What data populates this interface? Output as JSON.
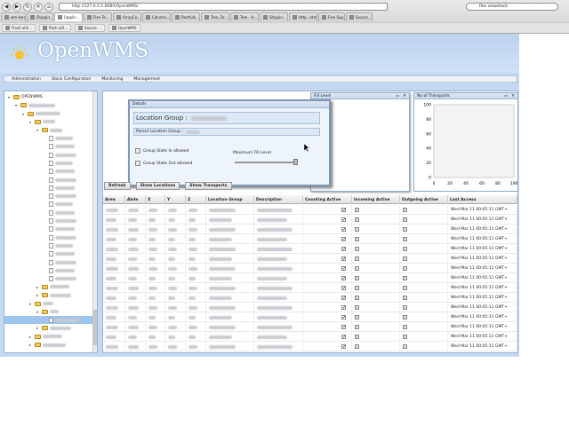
{
  "browser": {
    "url": "http://127.0.0.1:8080/OpenWMS/",
    "search": "flex viewstack",
    "tabs": [
      "wm-kern...",
      "Shippin...",
      "[applic...",
      "Flex Te...",
      "ArrayCo...",
      "Columni...",
      "Restfulk...",
      "Tree, Dr...",
      "Tree - A...",
      "Shippin...",
      "Http...html",
      "Flex Sup...",
      "Source ..."
    ],
    "active_tab_index": 2,
    "bookmarks": [
      "Flash utili...",
      "flash util...",
      "Source ...",
      "OpenWMS"
    ]
  },
  "app": {
    "logo": "OpenWMS",
    "menu": [
      "Administration",
      "Stock Configuration",
      "Monitoring",
      "Management"
    ]
  },
  "tree": {
    "root": "OPENWMS",
    "selected_index": 27
  },
  "fill_window": {
    "title": "Fill Level"
  },
  "transports_window": {
    "title": "No of Transports",
    "chart_data": {
      "type": "bar",
      "title": "",
      "ylim": [
        0,
        100
      ],
      "yticks": [
        "100",
        "80",
        "60",
        "40",
        "20",
        "0"
      ],
      "xticks": [
        "0",
        "20",
        "40",
        "60",
        "80",
        "100"
      ],
      "values": []
    }
  },
  "details": {
    "title": "Details",
    "location_group_label": "Location Group :",
    "parent_label": "Parent Location Group :",
    "state_in_label": "Group State In allowed",
    "state_out_label": "Group State Out allowed",
    "max_fill_label": "Maximum Fill Level"
  },
  "toolbar": {
    "refresh": "Refresh",
    "show_locations": "Show Locations",
    "show_transports": "Show Transports"
  },
  "grid": {
    "columns": [
      "Area",
      "Aisle",
      "X",
      "Y",
      "Z",
      "Location Group",
      "Description",
      "Counting Active",
      "Incoming Active",
      "Outgoing Active",
      "Last Access"
    ],
    "last_access": "Wed Mar 11 00:05:11 GMT+",
    "row_count": 15
  }
}
